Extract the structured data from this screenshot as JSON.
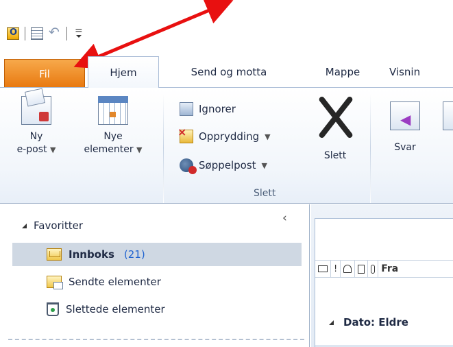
{
  "tabs": {
    "fil": "Fil",
    "hjem": "Hjem",
    "send": "Send og motta",
    "mappe": "Mappe",
    "visning": "Visnin"
  },
  "ribbon": {
    "new_email": [
      "Ny",
      "e-post"
    ],
    "new_items": [
      "Nye",
      "elementer"
    ],
    "ignore": "Ignorer",
    "cleanup": "Opprydding",
    "junk": "Søppelpost",
    "delete": "Slett",
    "delete_group": "Slett",
    "reply": "Svar"
  },
  "folders": {
    "favorites": "Favoritter",
    "items": [
      {
        "name": "Innboks",
        "count": "(21)"
      },
      {
        "name": "Sendte elementer"
      },
      {
        "name": "Slettede elementer"
      }
    ]
  },
  "messages": {
    "from_column": "Fra",
    "group_label": "Dato: Eldre"
  },
  "colors": {
    "fil_tab": "#e8780f",
    "selection": "#cfd8e3",
    "annotation_arrow": "#e81010"
  }
}
